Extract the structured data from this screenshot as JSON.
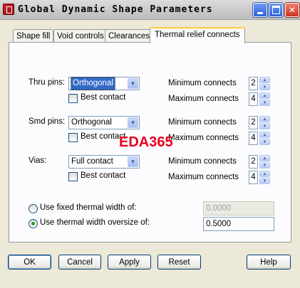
{
  "window": {
    "title": "Global Dynamic Shape Parameters"
  },
  "tabs": [
    {
      "label": "Shape fill"
    },
    {
      "label": "Void controls"
    },
    {
      "label": "Clearances"
    },
    {
      "label": "Thermal relief connects"
    }
  ],
  "rows": [
    {
      "label": "Thru pins:",
      "type": "Orthogonal",
      "best_contact": "Best contact",
      "best_contact_checked": false,
      "min_label": "Minimum connects",
      "min": "2",
      "max_label": "Maximum connects",
      "max": "4"
    },
    {
      "label": "Smd pins:",
      "type": "Orthogonal",
      "best_contact": "Best contact",
      "best_contact_checked": false,
      "min_label": "Minimum connects",
      "min": "2",
      "max_label": "Maximum connects",
      "max": "4"
    },
    {
      "label": "Vias:",
      "type": "Full contact",
      "best_contact": "Best contact",
      "best_contact_checked": false,
      "min_label": "Minimum connects",
      "min": "2",
      "max_label": "Maximum connects",
      "max": "4"
    }
  ],
  "thermal_width": {
    "fixed_label": "Use fixed thermal width of:",
    "fixed_value": "0.0000",
    "fixed_selected": false,
    "oversize_label": "Use thermal width oversize of:",
    "oversize_value": "0.5000",
    "oversize_selected": true
  },
  "watermark": "EDA365",
  "buttons": {
    "ok": "OK",
    "cancel": "Cancel",
    "apply": "Apply",
    "reset": "Reset",
    "help": "Help"
  },
  "colors": {
    "title_bar": "#c7c7c7",
    "active_tab_highlight": "#ffc83c",
    "selection": "#316ac5",
    "watermark": "#e8001f"
  }
}
